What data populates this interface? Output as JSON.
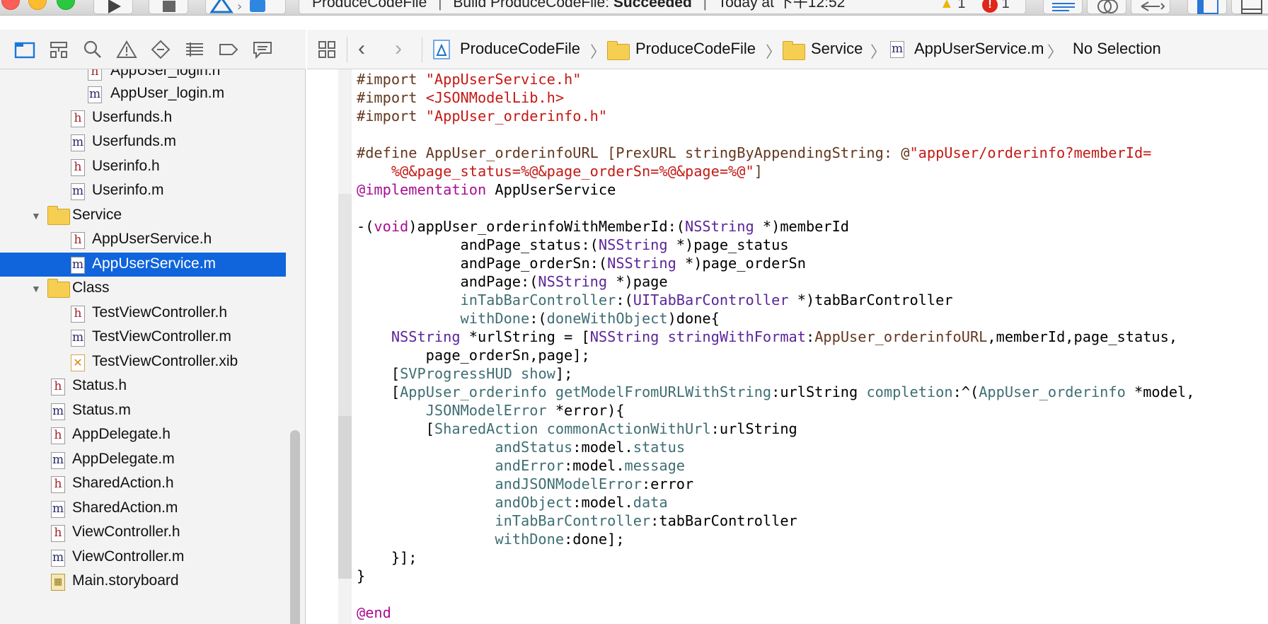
{
  "toolbar": {
    "activity_project": "ProduceCodeFile",
    "activity_build_prefix": "Build ProduceCodeFile:",
    "activity_build_status": "Succeeded",
    "activity_time": "Today at 下午12:52",
    "warning_count": "1",
    "error_count": "1"
  },
  "navigator": {
    "tabs": [
      "folder-icon",
      "hierarchy-icon",
      "search-icon",
      "warning-icon",
      "test-icon",
      "debug-icon",
      "breakpoint-icon",
      "report-icon"
    ],
    "items": [
      {
        "label": "AppUser_login.h",
        "type": "h"
      },
      {
        "label": "AppUser_login.m",
        "type": "m"
      },
      {
        "label": "Userfunds.h",
        "type": "h"
      },
      {
        "label": "Userfunds.m",
        "type": "m"
      },
      {
        "label": "Userinfo.h",
        "type": "h"
      },
      {
        "label": "Userinfo.m",
        "type": "m"
      },
      {
        "label": "Service",
        "type": "folder"
      },
      {
        "label": "AppUserService.h",
        "type": "h"
      },
      {
        "label": "AppUserService.m",
        "type": "m",
        "selected": true
      },
      {
        "label": "Class",
        "type": "folder"
      },
      {
        "label": "TestViewController.h",
        "type": "h"
      },
      {
        "label": "TestViewController.m",
        "type": "m"
      },
      {
        "label": "TestViewController.xib",
        "type": "xib"
      },
      {
        "label": "Status.h",
        "type": "h"
      },
      {
        "label": "Status.m",
        "type": "m"
      },
      {
        "label": "AppDelegate.h",
        "type": "h"
      },
      {
        "label": "AppDelegate.m",
        "type": "m"
      },
      {
        "label": "SharedAction.h",
        "type": "h"
      },
      {
        "label": "SharedAction.m",
        "type": "m"
      },
      {
        "label": "ViewController.h",
        "type": "h"
      },
      {
        "label": "ViewController.m",
        "type": "m"
      },
      {
        "label": "Main.storyboard",
        "type": "storyboard"
      }
    ]
  },
  "jumpbar": {
    "project": "ProduceCodeFile",
    "group": "ProduceCodeFile",
    "folder": "Service",
    "file": "AppUserService.m",
    "selection": "No Selection"
  },
  "editor": {
    "lines": [
      "#import \"AppUserService.h\"",
      "#import <JSONModelLib.h>",
      "#import \"AppUser_orderinfo.h\"",
      "",
      "#define AppUser_orderinfoURL [PrexURL stringByAppendingString: @\"appUser/orderinfo?memberId=",
      "    %@&page_status=%@&page_orderSn=%@&page=%@\"]",
      "@implementation AppUserService",
      "",
      "-(void)appUser_orderinfoWithMemberId:(NSString *)memberId",
      "            andPage_status:(NSString *)page_status",
      "            andPage_orderSn:(NSString *)page_orderSn",
      "            andPage:(NSString *)page",
      "            inTabBarController:(UITabBarController *)tabBarController",
      "            withDone:(doneWithObject)done{",
      "    NSString *urlString = [NSString stringWithFormat:AppUser_orderinfoURL,memberId,page_status,",
      "        page_orderSn,page];",
      "    [SVProgressHUD show];",
      "    [AppUser_orderinfo getModelFromURLWithString:urlString completion:^(AppUser_orderinfo *model,",
      "        JSONModelError *error){",
      "        [SharedAction commonActionWithUrl:urlString",
      "                andStatus:model.status",
      "                andError:model.message",
      "                andJSONModelError:error",
      "                andObject:model.data",
      "                inTabBarController:tabBarController",
      "                withDone:done];",
      "    }];",
      "}",
      "",
      "@end"
    ]
  },
  "colors": {
    "selection": "#1064dc",
    "string": "#c41a16",
    "keyword": "#aa0d91",
    "type": "#5c2699",
    "project_symbol": "#3f6e74",
    "preprocessor": "#643820"
  }
}
